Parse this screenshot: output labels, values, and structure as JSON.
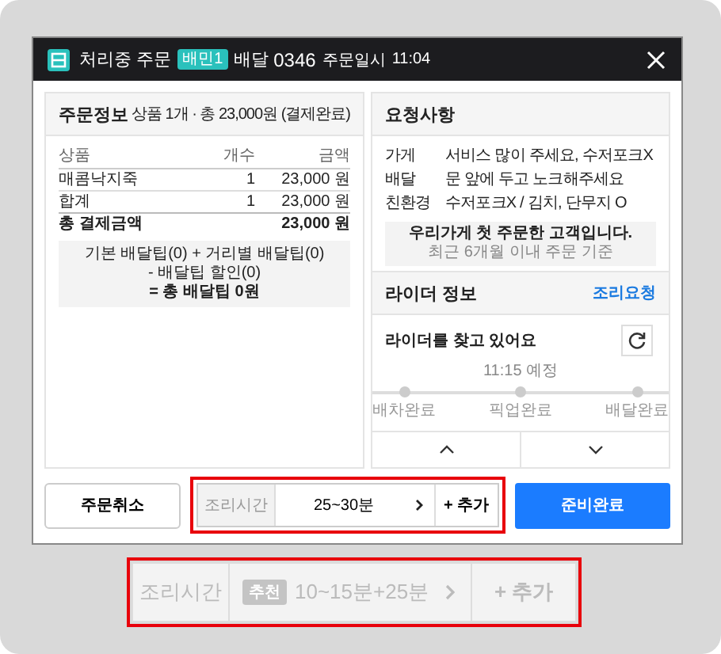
{
  "header": {
    "status": "처리중 주문",
    "channel_badge": "배민1",
    "order_type": "배달",
    "order_number": "0346",
    "order_time_label": "주문일시",
    "order_time": "11:04"
  },
  "order_info": {
    "title": "주문정보",
    "summary": "상품 1개 · 총 23,000원 (결제완료)",
    "columns": [
      "상품",
      "개수",
      "금액"
    ],
    "rows": [
      {
        "kind": "item",
        "name": "매콤낙지죽",
        "qty": "1",
        "amount": "23,000 원"
      },
      {
        "kind": "subtotal",
        "name": "합계",
        "qty": "1",
        "amount": "23,000 원"
      },
      {
        "kind": "total",
        "name": "총 결제금액",
        "amount": "23,000 원"
      }
    ],
    "delivery_tip": [
      {
        "text": "기본 배달팁(0) + 거리별 배달팁(0)",
        "bold": false
      },
      {
        "text": "- 배달팁 할인(0)",
        "bold": false
      },
      {
        "text": "= 총 배달팁 0원",
        "bold": true
      }
    ]
  },
  "requests": {
    "title": "요청사항",
    "rows": [
      {
        "label": "가게",
        "value": "서비스 많이 주세요, 수저포크X"
      },
      {
        "label": "배달",
        "value": "문 앞에 두고 노크해주세요"
      },
      {
        "label": "친환경",
        "value": "수저포크X / 김치, 단무지 O"
      }
    ],
    "notice": {
      "title": "우리가게 첫 주문한 고객입니다.",
      "subtitle": "최근 6개월 이내 주문 기준"
    }
  },
  "rider": {
    "title": "라이더 정보",
    "action": "조리요청",
    "status": "라이더를 찾고 있어요",
    "eta": "11:15 예정",
    "steps": [
      {
        "label": "배차완료",
        "done": false
      },
      {
        "label": "픽업완료",
        "done": false
      },
      {
        "label": "배달완료",
        "done": false
      }
    ]
  },
  "footer": {
    "cancel": "주문취소",
    "cook_time": {
      "label": "조리시간",
      "value": "25~30분",
      "add": "+ 추가",
      "highlighted": true
    },
    "confirm": "준비완료"
  },
  "preview": {
    "label": "조리시간",
    "badge": "추천",
    "value": "10~15분+25분",
    "add": "+ 추가",
    "highlighted": true
  }
}
